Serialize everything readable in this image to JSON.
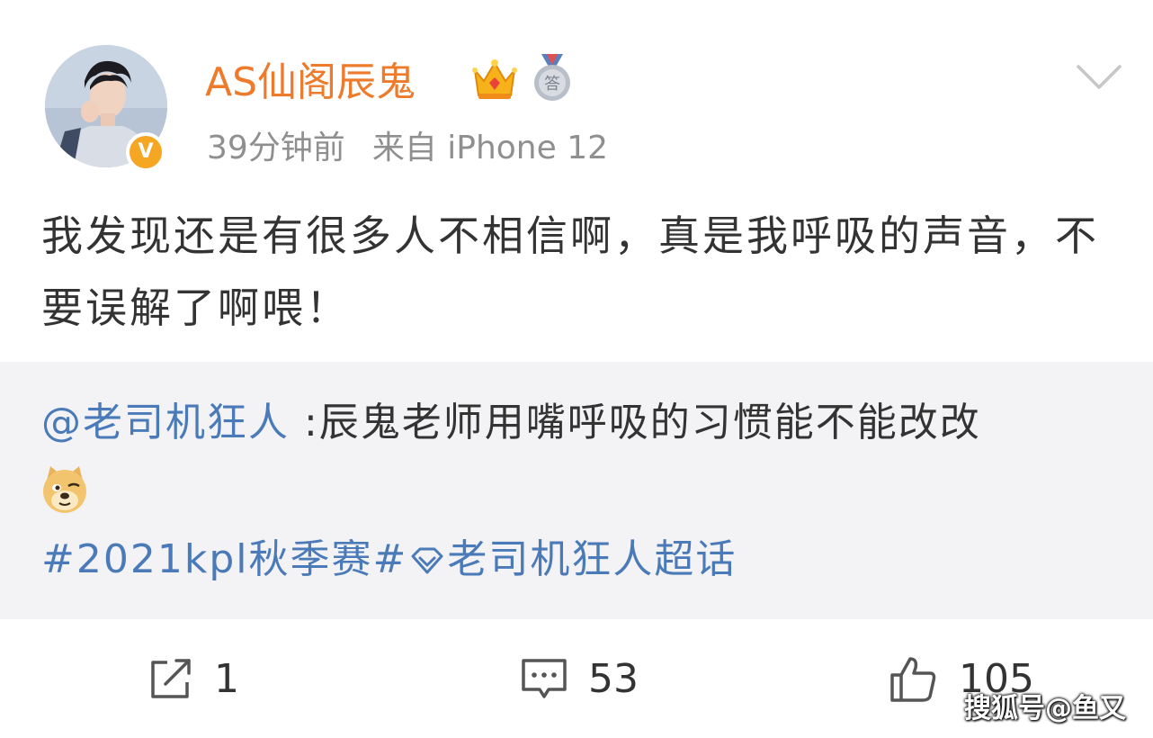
{
  "post": {
    "username": "AS仙阁辰鬼",
    "verified_mark": "V",
    "medal_char": "答",
    "time": "39分钟前",
    "source": "来自 iPhone 12",
    "text": "我发现还是有很多人不相信啊，真是我呼吸的声音，不要误解了啊喂！"
  },
  "repost": {
    "mention": "@老司机狂人",
    "text": " :辰鬼老师用嘴呼吸的习惯能不能改改",
    "emoji": "doge-emoji",
    "hashtag_1": "#2021kpl秋季赛#",
    "hashtag_2": "老司机狂人超话"
  },
  "actions": {
    "repost_count": "1",
    "comment_count": "53",
    "like_count": "105"
  },
  "watermark": "搜狐号@鱼又",
  "colors": {
    "username": "#ee7b2b",
    "link": "#4a7ab8",
    "meta": "#8f8f8f",
    "repost_bg": "#f3f3f5",
    "verified": "#f5a623"
  },
  "icons": [
    "crown-icon",
    "medal-icon",
    "chevron-down-icon",
    "doge-emoji",
    "supertopic-icon",
    "repost-icon",
    "comment-icon",
    "like-icon",
    "verified-icon"
  ]
}
